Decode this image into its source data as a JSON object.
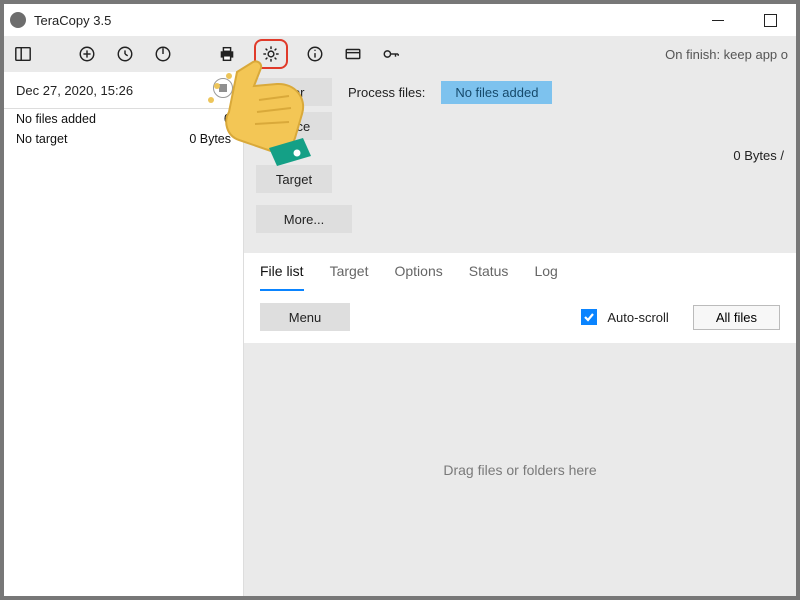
{
  "window": {
    "title": "TeraCopy 3.5"
  },
  "toolbar": {
    "on_finish": "On finish: keep app o"
  },
  "job": {
    "date": "Dec 27, 2020, 15:26",
    "line1_left": "No files added",
    "line1_right": "0",
    "line2_left": "No target",
    "line2_right": "0 Bytes"
  },
  "panel": {
    "filter_btn": "ilter",
    "source_btn": "ource",
    "target_btn": "Target",
    "more_btn": "More...",
    "process_label": "Process files:",
    "process_pill": "No files added",
    "summary": "0 Bytes / "
  },
  "tabs": {
    "file_list": "File list",
    "target": "Target",
    "options": "Options",
    "status": "Status",
    "log": "Log"
  },
  "actions": {
    "menu_btn": "Menu",
    "autoscroll_label": "Auto-scroll",
    "allfiles_btn": "All files"
  },
  "dropzone": {
    "hint": "Drag files or folders here"
  }
}
